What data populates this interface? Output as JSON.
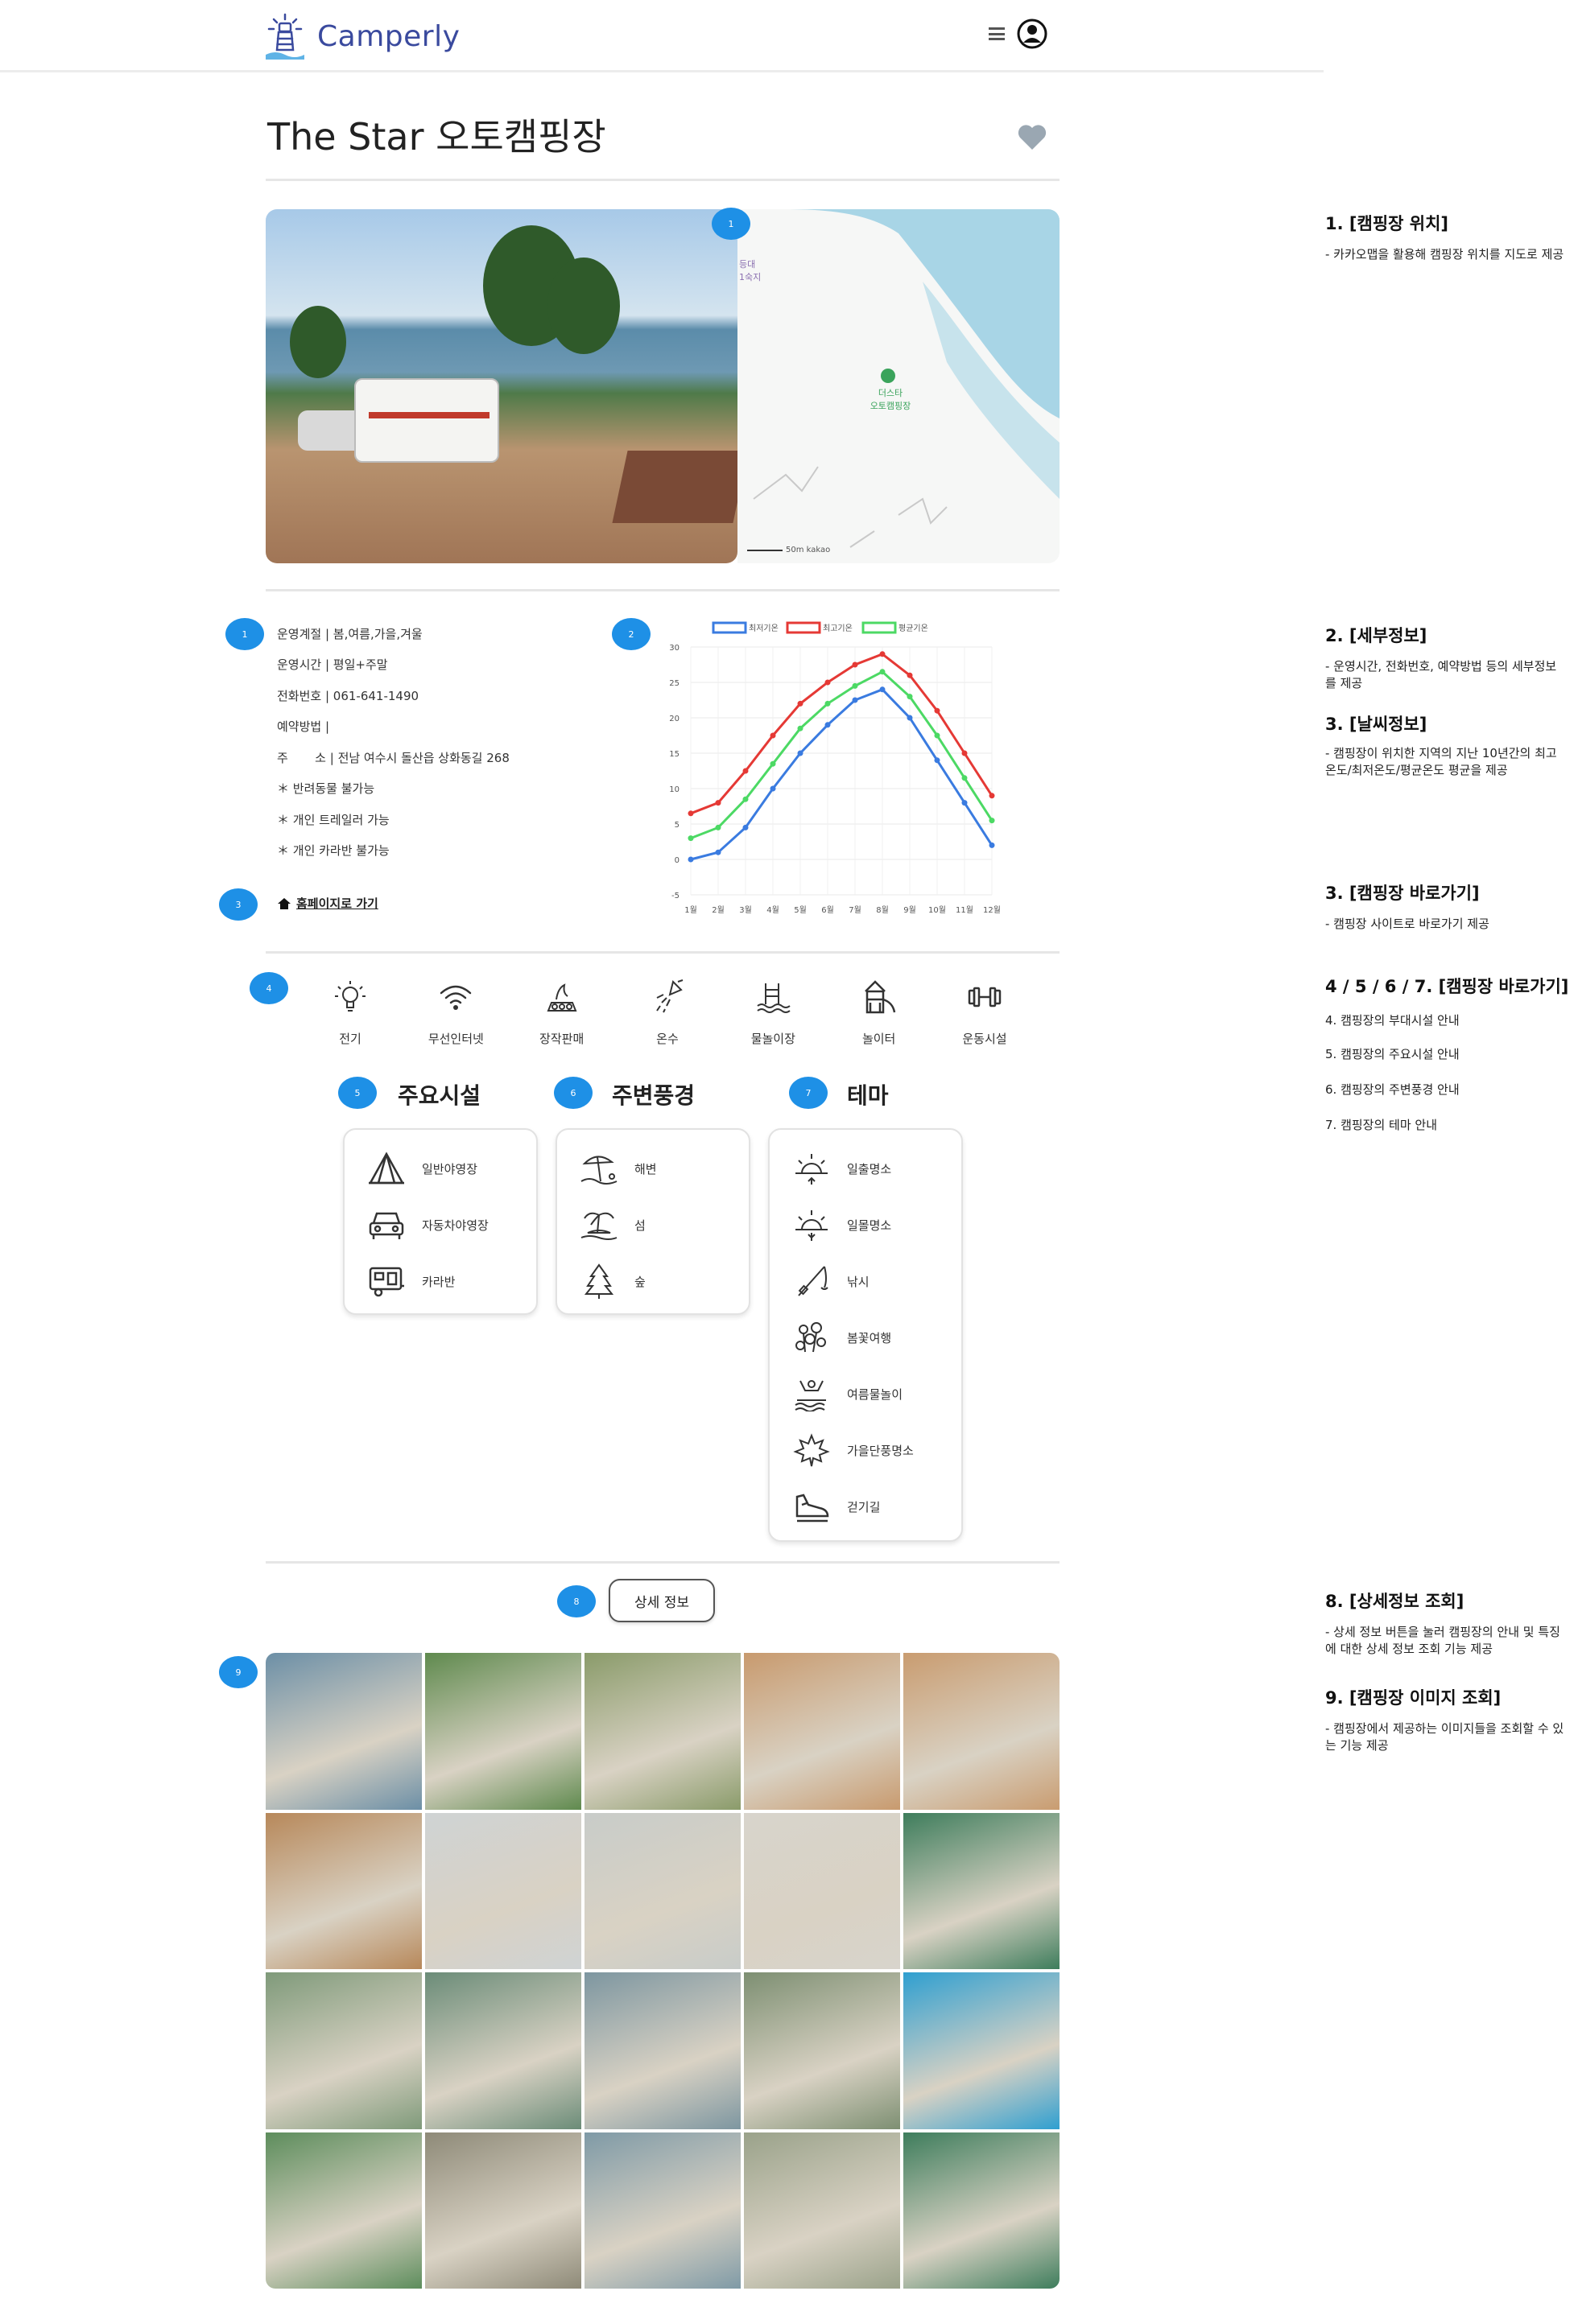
{
  "header": {
    "logo_text": "Camperly",
    "menu_icon": "hamburger-icon",
    "profile_icon": "user-circle-icon"
  },
  "title": {
    "text": "The Star 오토캠핑장",
    "favorite_icon": "heart-icon"
  },
  "map": {
    "place_label": "더스타\n오토캠핑장",
    "scale": "50m kakao"
  },
  "badges": [
    "1",
    "1",
    "2",
    "3",
    "4",
    "5",
    "6",
    "7",
    "8",
    "9"
  ],
  "info": {
    "rows": [
      "운영계절 | 봄,여름,가을,겨울",
      "운영시간 | 평일+주말",
      "전화번호 | 061-641-1490",
      "예약방법 |",
      "주       소 | 전남 여수시 돌산읍 상화동길 268",
      "＊ 반려동물 불가능",
      "＊ 개인 트레일러 가능",
      "＊ 개인 카라반 불가능"
    ],
    "homepage_link": "홈페이지로 가기"
  },
  "chart_data": {
    "type": "line",
    "title": "",
    "xlabel": "",
    "ylabel": "",
    "x": [
      "1월",
      "2월",
      "3월",
      "4월",
      "5월",
      "6월",
      "7월",
      "8월",
      "9월",
      "10월",
      "11월",
      "12월"
    ],
    "ylim": [
      -5,
      30
    ],
    "yticks": [
      -5,
      0,
      5,
      10,
      15,
      20,
      25,
      30
    ],
    "grid": true,
    "legend_position": "top",
    "series": [
      {
        "name": "최저기온",
        "color": "#3a7be0",
        "values": [
          0,
          1,
          4.5,
          10,
          15,
          19,
          22.5,
          24,
          20,
          14,
          8,
          2
        ]
      },
      {
        "name": "최고기온",
        "color": "#e53935",
        "values": [
          6.5,
          8,
          12.5,
          17.5,
          22,
          25,
          27.5,
          29,
          26,
          21,
          15,
          9
        ]
      },
      {
        "name": "평균기온",
        "color": "#4cd964",
        "values": [
          3,
          4.5,
          8.5,
          13.5,
          18.5,
          22,
          24.5,
          26.5,
          23,
          17.5,
          11.5,
          5.5
        ]
      }
    ]
  },
  "facilities": [
    {
      "label": "전기",
      "icon": "lightbulb-icon"
    },
    {
      "label": "무선인터넷",
      "icon": "wifi-icon"
    },
    {
      "label": "장작판매",
      "icon": "firewood-icon"
    },
    {
      "label": "온수",
      "icon": "shower-icon"
    },
    {
      "label": "물놀이장",
      "icon": "pool-icon"
    },
    {
      "label": "놀이터",
      "icon": "playground-icon"
    },
    {
      "label": "운동시설",
      "icon": "dumbbell-icon"
    }
  ],
  "sections": {
    "main": {
      "title": "주요시설",
      "items": [
        {
          "label": "일반야영장",
          "icon": "tent-icon"
        },
        {
          "label": "자동차야영장",
          "icon": "car-icon"
        },
        {
          "label": "카라반",
          "icon": "caravan-icon"
        }
      ]
    },
    "scenery": {
      "title": "주변풍경",
      "items": [
        {
          "label": "해변",
          "icon": "beach-icon"
        },
        {
          "label": "섬",
          "icon": "island-icon"
        },
        {
          "label": "숲",
          "icon": "forest-icon"
        }
      ]
    },
    "theme": {
      "title": "테마",
      "items": [
        {
          "label": "일출명소",
          "icon": "sunrise-icon"
        },
        {
          "label": "일몰명소",
          "icon": "sunset-icon"
        },
        {
          "label": "낚시",
          "icon": "fishing-icon"
        },
        {
          "label": "봄꽃여행",
          "icon": "flower-icon"
        },
        {
          "label": "여름물놀이",
          "icon": "swimming-icon"
        },
        {
          "label": "가을단풍명소",
          "icon": "maple-leaf-icon"
        },
        {
          "label": "걷기길",
          "icon": "walking-shoe-icon"
        }
      ]
    }
  },
  "detail_button": "상세 정보",
  "gallery": {
    "images": [
      "#6c8fa6",
      "#5f8a4e",
      "#8a9b6a",
      "#c89a6e",
      "#c99c70",
      "#b7885a",
      "#cfd3d4",
      "#c8ccc9",
      "#d8d4cc",
      "#3e7d5c",
      "#7f9a7a",
      "#6b8c78",
      "#7d96a0",
      "#7d8f72",
      "#2f9fd0",
      "#5d8d5c",
      "#8e8a78",
      "#7f9aa6",
      "#9aa28a",
      "#3e7d5c"
    ]
  },
  "notes": [
    {
      "title": "1. [캠핑장 위치]",
      "body": "- 카카오맵을 활용해 캠핑장 위치를 지도로 제공"
    },
    {
      "title": "2. [세부정보]",
      "body": "- 운영시간, 전화번호, 예약방법 등의 세부정보를 제공"
    },
    {
      "title": "3. [날씨정보]",
      "body": "- 캠핑장이 위치한 지역의 지난 10년간의 최고온도/최저온도/평균온도 평균을 제공"
    },
    {
      "title": "3. [캠핑장 바로가기]",
      "body": "- 캠핑장 사이트로 바로가기 제공"
    },
    {
      "title": "4 / 5 / 6 / 7. [캠핑장 바로가기]",
      "body": "4. 캠핑장의 부대시설 안내"
    },
    {
      "title": "",
      "body": "5. 캠핑장의 주요시설 안내"
    },
    {
      "title": "",
      "body": "6. 캠핑장의 주변풍경 안내"
    },
    {
      "title": "",
      "body": "7. 캠핑장의 테마 안내"
    },
    {
      "title": "8. [상세정보 조회]",
      "body": "- 상세 정보 버튼을 눌러 캠핑장의 안내 및 특징에 대한 상세 정보 조회 기능 제공"
    },
    {
      "title": "9. [캠핑장 이미지 조회]",
      "body": "- 캠핑장에서 제공하는 이미지들을 조회할 수 있는 기능 제공"
    }
  ]
}
